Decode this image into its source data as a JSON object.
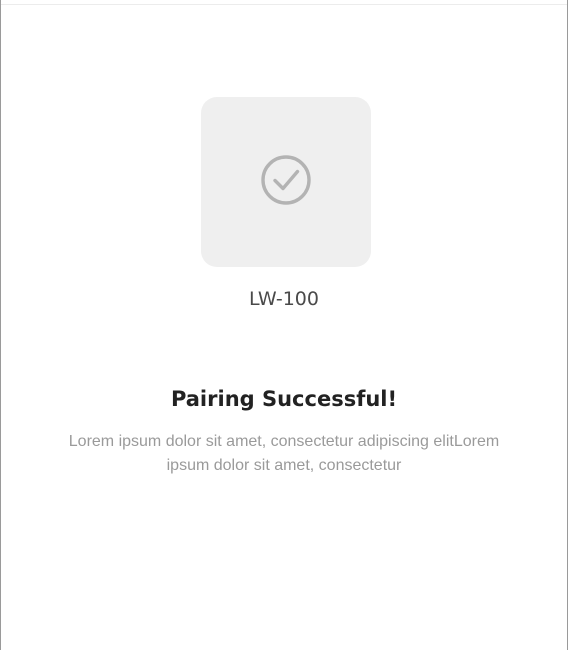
{
  "device": {
    "icon": "check-circle-icon",
    "name": "LW-100"
  },
  "status": {
    "title": "Pairing Successful!",
    "description": "Lorem ipsum dolor sit amet, consectetur adipiscing elitLorem ipsum dolor sit amet, consectetur"
  },
  "colors": {
    "tile_background": "#efefef",
    "icon_stroke": "#b3b3b3",
    "title_text": "#222222",
    "body_text": "#9a9a9a"
  }
}
